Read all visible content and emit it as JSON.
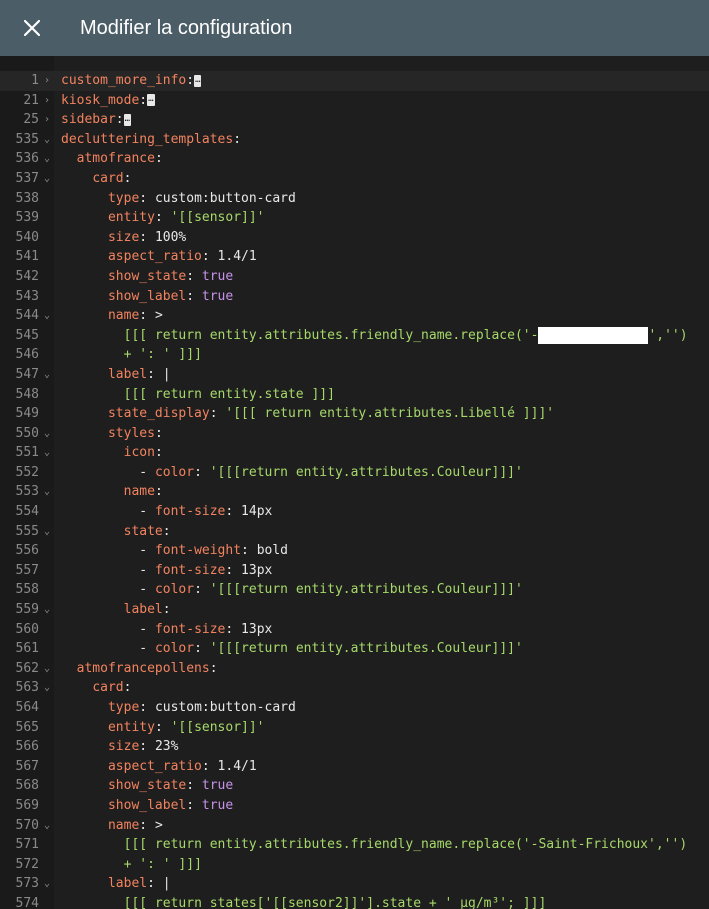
{
  "header": {
    "title": "Modifier la configuration",
    "close_icon": "close-icon"
  },
  "lines": [
    {
      "n": "1",
      "fold": "›",
      "active": true,
      "indent": 0,
      "parts": [
        {
          "c": "k",
          "t": "custom_more_info"
        },
        {
          "c": "p",
          "t": ":"
        },
        {
          "c": "ell",
          "t": "…"
        }
      ]
    },
    {
      "n": "21",
      "fold": "›",
      "indent": 0,
      "parts": [
        {
          "c": "k",
          "t": "kiosk_mode"
        },
        {
          "c": "p",
          "t": ":"
        },
        {
          "c": "ell",
          "t": "…"
        }
      ]
    },
    {
      "n": "25",
      "fold": "›",
      "indent": 0,
      "parts": [
        {
          "c": "k",
          "t": "sidebar"
        },
        {
          "c": "p",
          "t": ":"
        },
        {
          "c": "ell",
          "t": "…"
        }
      ]
    },
    {
      "n": "535",
      "fold": "⌄",
      "indent": 0,
      "parts": [
        {
          "c": "k",
          "t": "decluttering_templates"
        },
        {
          "c": "p",
          "t": ":"
        }
      ]
    },
    {
      "n": "536",
      "fold": "⌄",
      "indent": 2,
      "parts": [
        {
          "c": "k",
          "t": "atmofrance"
        },
        {
          "c": "p",
          "t": ":"
        }
      ]
    },
    {
      "n": "537",
      "fold": "⌄",
      "indent": 4,
      "parts": [
        {
          "c": "k",
          "t": "card"
        },
        {
          "c": "p",
          "t": ":"
        }
      ]
    },
    {
      "n": "538",
      "fold": "",
      "indent": 6,
      "parts": [
        {
          "c": "k",
          "t": "type"
        },
        {
          "c": "p",
          "t": ": "
        },
        {
          "c": "pl",
          "t": "custom:button-card"
        }
      ]
    },
    {
      "n": "539",
      "fold": "",
      "indent": 6,
      "parts": [
        {
          "c": "k",
          "t": "entity"
        },
        {
          "c": "p",
          "t": ": "
        },
        {
          "c": "s",
          "t": "'[[sensor]]'"
        }
      ]
    },
    {
      "n": "540",
      "fold": "",
      "indent": 6,
      "parts": [
        {
          "c": "k",
          "t": "size"
        },
        {
          "c": "p",
          "t": ": "
        },
        {
          "c": "pl",
          "t": "100%"
        }
      ]
    },
    {
      "n": "541",
      "fold": "",
      "indent": 6,
      "parts": [
        {
          "c": "k",
          "t": "aspect_ratio"
        },
        {
          "c": "p",
          "t": ": "
        },
        {
          "c": "pl",
          "t": "1.4/1"
        }
      ]
    },
    {
      "n": "542",
      "fold": "",
      "indent": 6,
      "parts": [
        {
          "c": "k",
          "t": "show_state"
        },
        {
          "c": "p",
          "t": ": "
        },
        {
          "c": "b",
          "t": "true"
        }
      ]
    },
    {
      "n": "543",
      "fold": "",
      "indent": 6,
      "parts": [
        {
          "c": "k",
          "t": "show_label"
        },
        {
          "c": "p",
          "t": ": "
        },
        {
          "c": "b",
          "t": "true"
        }
      ]
    },
    {
      "n": "544",
      "fold": "⌄",
      "indent": 6,
      "parts": [
        {
          "c": "k",
          "t": "name"
        },
        {
          "c": "p",
          "t": ": "
        },
        {
          "c": "pl",
          "t": ">"
        }
      ]
    },
    {
      "n": "545",
      "fold": "",
      "indent": 8,
      "parts": [
        {
          "c": "s",
          "t": "[[[ return entity.attributes.friendly_name.replace('-"
        },
        {
          "c": "redact",
          "t": ""
        },
        {
          "c": "s",
          "t": "','')"
        }
      ]
    },
    {
      "n": "546",
      "fold": "",
      "indent": 8,
      "parts": [
        {
          "c": "s",
          "t": "+ ': ' ]]]"
        }
      ]
    },
    {
      "n": "547",
      "fold": "⌄",
      "indent": 6,
      "parts": [
        {
          "c": "k",
          "t": "label"
        },
        {
          "c": "p",
          "t": ": "
        },
        {
          "c": "pl",
          "t": "|"
        }
      ]
    },
    {
      "n": "548",
      "fold": "",
      "indent": 8,
      "parts": [
        {
          "c": "s",
          "t": "[[[ return entity.state ]]]"
        }
      ]
    },
    {
      "n": "549",
      "fold": "",
      "indent": 6,
      "parts": [
        {
          "c": "k",
          "t": "state_display"
        },
        {
          "c": "p",
          "t": ": "
        },
        {
          "c": "s",
          "t": "'[[[ return entity.attributes.Libellé ]]]'"
        }
      ]
    },
    {
      "n": "550",
      "fold": "⌄",
      "indent": 6,
      "parts": [
        {
          "c": "k",
          "t": "styles"
        },
        {
          "c": "p",
          "t": ":"
        }
      ]
    },
    {
      "n": "551",
      "fold": "⌄",
      "indent": 8,
      "parts": [
        {
          "c": "k",
          "t": "icon"
        },
        {
          "c": "p",
          "t": ":"
        }
      ]
    },
    {
      "n": "552",
      "fold": "",
      "indent": 10,
      "parts": [
        {
          "c": "p",
          "t": "- "
        },
        {
          "c": "k",
          "t": "color"
        },
        {
          "c": "p",
          "t": ": "
        },
        {
          "c": "s",
          "t": "'[[[return entity.attributes.Couleur]]]'"
        }
      ]
    },
    {
      "n": "553",
      "fold": "⌄",
      "indent": 8,
      "parts": [
        {
          "c": "k",
          "t": "name"
        },
        {
          "c": "p",
          "t": ":"
        }
      ]
    },
    {
      "n": "554",
      "fold": "",
      "indent": 10,
      "parts": [
        {
          "c": "p",
          "t": "- "
        },
        {
          "c": "k",
          "t": "font-size"
        },
        {
          "c": "p",
          "t": ": "
        },
        {
          "c": "pl",
          "t": "14px"
        }
      ]
    },
    {
      "n": "555",
      "fold": "⌄",
      "indent": 8,
      "parts": [
        {
          "c": "k",
          "t": "state"
        },
        {
          "c": "p",
          "t": ":"
        }
      ]
    },
    {
      "n": "556",
      "fold": "",
      "indent": 10,
      "parts": [
        {
          "c": "p",
          "t": "- "
        },
        {
          "c": "k",
          "t": "font-weight"
        },
        {
          "c": "p",
          "t": ": "
        },
        {
          "c": "pl",
          "t": "bold"
        }
      ]
    },
    {
      "n": "557",
      "fold": "",
      "indent": 10,
      "parts": [
        {
          "c": "p",
          "t": "- "
        },
        {
          "c": "k",
          "t": "font-size"
        },
        {
          "c": "p",
          "t": ": "
        },
        {
          "c": "pl",
          "t": "13px"
        }
      ]
    },
    {
      "n": "558",
      "fold": "",
      "indent": 10,
      "parts": [
        {
          "c": "p",
          "t": "- "
        },
        {
          "c": "k",
          "t": "color"
        },
        {
          "c": "p",
          "t": ": "
        },
        {
          "c": "s",
          "t": "'[[[return entity.attributes.Couleur]]]'"
        }
      ]
    },
    {
      "n": "559",
      "fold": "⌄",
      "indent": 8,
      "parts": [
        {
          "c": "k",
          "t": "label"
        },
        {
          "c": "p",
          "t": ":"
        }
      ]
    },
    {
      "n": "560",
      "fold": "",
      "indent": 10,
      "parts": [
        {
          "c": "p",
          "t": "- "
        },
        {
          "c": "k",
          "t": "font-size"
        },
        {
          "c": "p",
          "t": ": "
        },
        {
          "c": "pl",
          "t": "13px"
        }
      ]
    },
    {
      "n": "561",
      "fold": "",
      "indent": 10,
      "parts": [
        {
          "c": "p",
          "t": "- "
        },
        {
          "c": "k",
          "t": "color"
        },
        {
          "c": "p",
          "t": ": "
        },
        {
          "c": "s",
          "t": "'[[[return entity.attributes.Couleur]]]'"
        }
      ]
    },
    {
      "n": "562",
      "fold": "⌄",
      "indent": 2,
      "parts": [
        {
          "c": "k",
          "t": "atmofrancepollens"
        },
        {
          "c": "p",
          "t": ":"
        }
      ]
    },
    {
      "n": "563",
      "fold": "⌄",
      "indent": 4,
      "parts": [
        {
          "c": "k",
          "t": "card"
        },
        {
          "c": "p",
          "t": ":"
        }
      ]
    },
    {
      "n": "564",
      "fold": "",
      "indent": 6,
      "parts": [
        {
          "c": "k",
          "t": "type"
        },
        {
          "c": "p",
          "t": ": "
        },
        {
          "c": "pl",
          "t": "custom:button-card"
        }
      ]
    },
    {
      "n": "565",
      "fold": "",
      "indent": 6,
      "parts": [
        {
          "c": "k",
          "t": "entity"
        },
        {
          "c": "p",
          "t": ": "
        },
        {
          "c": "s",
          "t": "'[[sensor]]'"
        }
      ]
    },
    {
      "n": "566",
      "fold": "",
      "indent": 6,
      "parts": [
        {
          "c": "k",
          "t": "size"
        },
        {
          "c": "p",
          "t": ": "
        },
        {
          "c": "pl",
          "t": "23%"
        }
      ]
    },
    {
      "n": "567",
      "fold": "",
      "indent": 6,
      "parts": [
        {
          "c": "k",
          "t": "aspect_ratio"
        },
        {
          "c": "p",
          "t": ": "
        },
        {
          "c": "pl",
          "t": "1.4/1"
        }
      ]
    },
    {
      "n": "568",
      "fold": "",
      "indent": 6,
      "parts": [
        {
          "c": "k",
          "t": "show_state"
        },
        {
          "c": "p",
          "t": ": "
        },
        {
          "c": "b",
          "t": "true"
        }
      ]
    },
    {
      "n": "569",
      "fold": "",
      "indent": 6,
      "parts": [
        {
          "c": "k",
          "t": "show_label"
        },
        {
          "c": "p",
          "t": ": "
        },
        {
          "c": "b",
          "t": "true"
        }
      ]
    },
    {
      "n": "570",
      "fold": "⌄",
      "indent": 6,
      "parts": [
        {
          "c": "k",
          "t": "name"
        },
        {
          "c": "p",
          "t": ": "
        },
        {
          "c": "pl",
          "t": ">"
        }
      ]
    },
    {
      "n": "571",
      "fold": "",
      "indent": 8,
      "parts": [
        {
          "c": "s",
          "t": "[[[ return entity.attributes.friendly_name.replace('-Saint-Frichoux','')"
        }
      ]
    },
    {
      "n": "572",
      "fold": "",
      "indent": 8,
      "parts": [
        {
          "c": "s",
          "t": "+ ': ' ]]]"
        }
      ]
    },
    {
      "n": "573",
      "fold": "⌄",
      "indent": 6,
      "parts": [
        {
          "c": "k",
          "t": "label"
        },
        {
          "c": "p",
          "t": ": "
        },
        {
          "c": "pl",
          "t": "|"
        }
      ]
    },
    {
      "n": "574",
      "fold": "",
      "indent": 8,
      "parts": [
        {
          "c": "s",
          "t": "[[[ return states['[[sensor2]]'].state + ' µg/m³'; ]]]"
        }
      ]
    }
  ]
}
